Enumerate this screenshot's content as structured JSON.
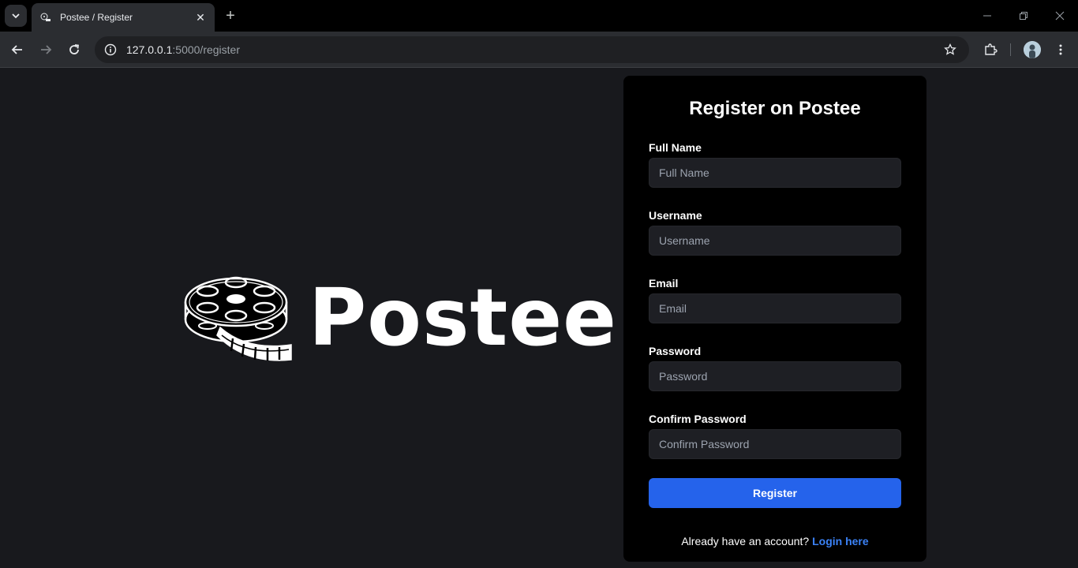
{
  "browser": {
    "tab_title": "Postee / Register",
    "url_host": "127.0.0.1",
    "url_path": ":5000/register",
    "close_glyph": "✕",
    "new_tab_glyph": "+"
  },
  "icons": {
    "tab_search": "chevron-down-icon",
    "back": "arrow-left-icon",
    "forward": "arrow-right-icon",
    "reload": "reload-icon",
    "site_info": "info-icon",
    "bookmark": "star-icon",
    "extensions": "puzzle-icon",
    "menu": "kebab-menu-icon"
  },
  "brand": {
    "name": "Postee"
  },
  "form": {
    "title": "Register on Postee",
    "fields": [
      {
        "label": "Full Name",
        "placeholder": "Full Name",
        "value": ""
      },
      {
        "label": "Username",
        "placeholder": "Username",
        "value": ""
      },
      {
        "label": "Email",
        "placeholder": "Email",
        "value": ""
      },
      {
        "label": "Password",
        "placeholder": "Password",
        "value": ""
      },
      {
        "label": "Confirm Password",
        "placeholder": "Confirm Password",
        "value": ""
      }
    ],
    "submit_label": "Register",
    "footer_text": "Already have an account?",
    "footer_link": "Login here"
  },
  "colors": {
    "page_bg": "#18191d",
    "card_bg": "#000000",
    "input_bg": "#1e1f24",
    "button_bg": "#2563eb",
    "link": "#3b82f6"
  }
}
